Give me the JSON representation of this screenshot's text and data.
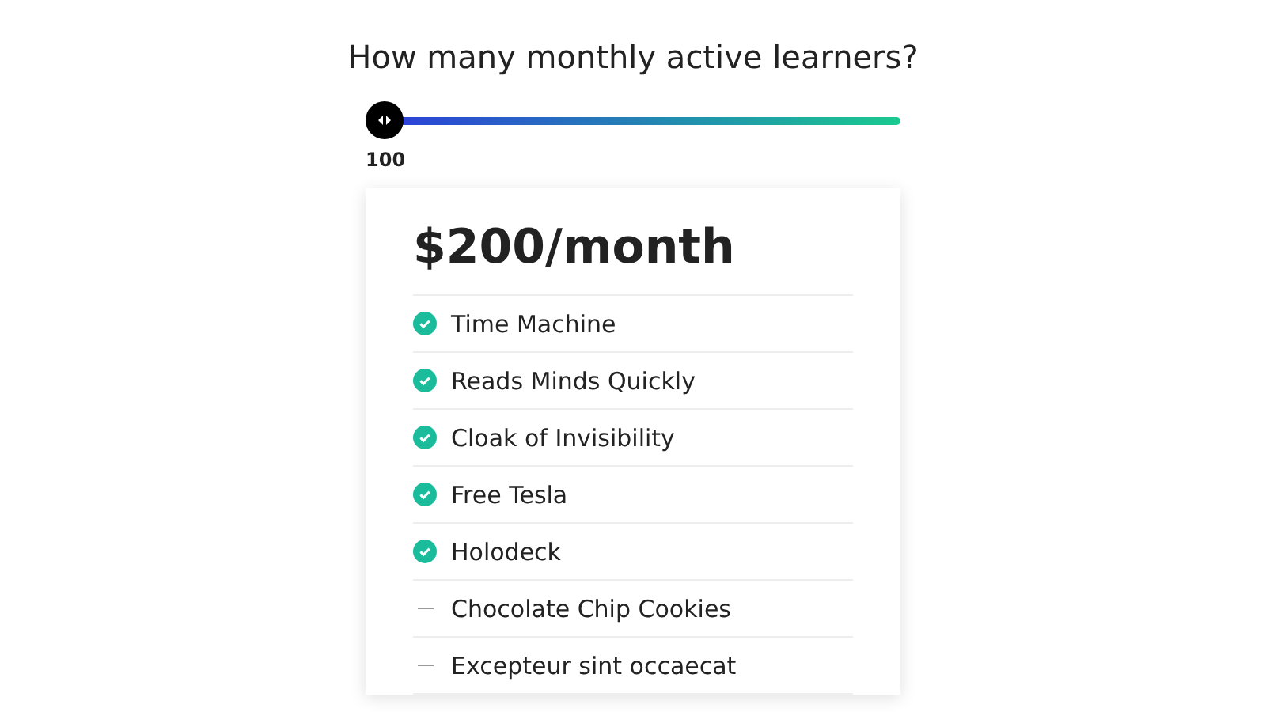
{
  "heading": "How many monthly active learners?",
  "slider": {
    "level": 0,
    "reading": "100"
  },
  "plan": {
    "price": "$200/month",
    "features": [
      {
        "label": "Time Machine",
        "included": true
      },
      {
        "label": "Reads Minds Quickly",
        "included": true
      },
      {
        "label": "Cloak of Invisibility",
        "included": true
      },
      {
        "label": "Free Tesla",
        "included": true
      },
      {
        "label": "Holodeck",
        "included": true
      },
      {
        "label": "Chocolate Chip Cookies",
        "included": false
      },
      {
        "label": "Excepteur sint occaecat",
        "included": false
      }
    ]
  }
}
